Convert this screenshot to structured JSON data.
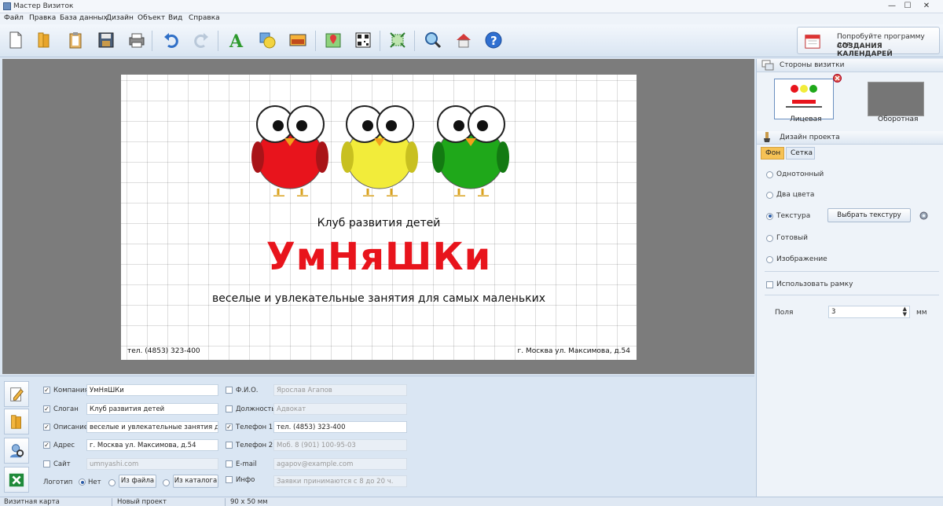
{
  "window": {
    "title": "Мастер Визиток",
    "minimize": "—",
    "maximize": "☐",
    "close": "✕"
  },
  "menu": [
    "Файл",
    "Правка",
    "База данных",
    "Дизайн",
    "Объект",
    "Вид",
    "Справка"
  ],
  "toolbar": {
    "icons": [
      "new-file-icon",
      "open-folder-icon",
      "clipboard-icon",
      "save-icon",
      "print-icon",
      "undo-icon",
      "redo-icon",
      "text-icon",
      "shapes-icon",
      "image-icon",
      "map-icon",
      "qr-code-icon",
      "fit-icon",
      "zoom-icon",
      "home-icon",
      "help-icon"
    ],
    "promo": {
      "line1": "Попробуйте программу для",
      "line2": "СОЗДАНИЯ КАЛЕНДАРЕЙ"
    }
  },
  "card": {
    "club": "Клуб развития детей",
    "brand": "УмНяШКи",
    "slogan": "веселые и увлекательные занятия для самых маленьких",
    "phone": "тел. (4853) 323-400",
    "address": "г. Москва ул. Максимова, д.54",
    "owl_colors": [
      "#e8141c",
      "#f2ec3a",
      "#1fa81a"
    ]
  },
  "fields": {
    "company": {
      "label": "Компания",
      "value": "УмНяШКи",
      "checked": true
    },
    "slogan": {
      "label": "Слоган",
      "value": "Клуб развития детей",
      "checked": true
    },
    "description": {
      "label": "Описание",
      "value": "веселые и увлекательные занятия для самых маленьких",
      "checked": true
    },
    "address": {
      "label": "Адрес",
      "value": "г. Москва ул. Максимова, д.54",
      "checked": true
    },
    "site": {
      "label": "Сайт",
      "value": "umnyashi.com",
      "checked": false
    },
    "fio": {
      "label": "Ф.И.О.",
      "value": "Ярослав Агапов",
      "checked": false
    },
    "position": {
      "label": "Должность",
      "value": "Адвокат",
      "checked": false
    },
    "phone1": {
      "label": "Телефон 1",
      "value": "тел. (4853) 323-400",
      "checked": true
    },
    "phone2": {
      "label": "Телефон 2",
      "value": "Моб. 8 (901) 100-95-03",
      "checked": false
    },
    "email": {
      "label": "E-mail",
      "value": "agapov@example.com",
      "checked": false
    },
    "info": {
      "label": "Инфо",
      "value": "Заявки принимаются с 8 до 20 ч.",
      "checked": false
    },
    "logo": {
      "label": "Логотип",
      "none": "Нет",
      "from_file": "Из файла",
      "from_catalog": "Из каталога"
    }
  },
  "status": [
    "Визитная карта",
    "Новый проект",
    "90 x 50 мм"
  ],
  "right_panel": {
    "sides_title": "Стороны визитки",
    "front": "Лицевая",
    "back": "Оборотная",
    "design_title": "Дизайн проекта",
    "tabs": [
      "Фон",
      "Сетка"
    ],
    "options": [
      "Однотонный",
      "Два цвета",
      "Текстура",
      "Готовый",
      "Изображение"
    ],
    "selected_option": "Текстура",
    "texture_button": "Выбрать текстуру",
    "use_frame": "Использовать рамку",
    "margin_label": "Поля",
    "margin_value": "3",
    "margin_unit": "мм"
  }
}
